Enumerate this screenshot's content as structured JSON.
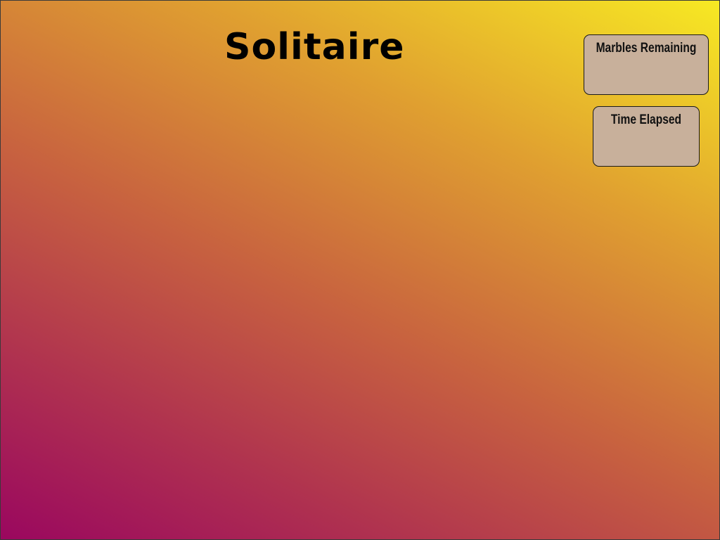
{
  "title": "Solitaire",
  "panels": {
    "marbles": {
      "label": "Marbles Remaining",
      "value": ""
    },
    "time": {
      "label": "Time Elapsed",
      "value": ""
    }
  },
  "colors": {
    "gradient_bottom_left": "#9a075f",
    "gradient_top_right": "#f7e923",
    "panel_fill": "#c8b09b",
    "panel_border": "#1a1a1a",
    "title_text": "#000000"
  }
}
